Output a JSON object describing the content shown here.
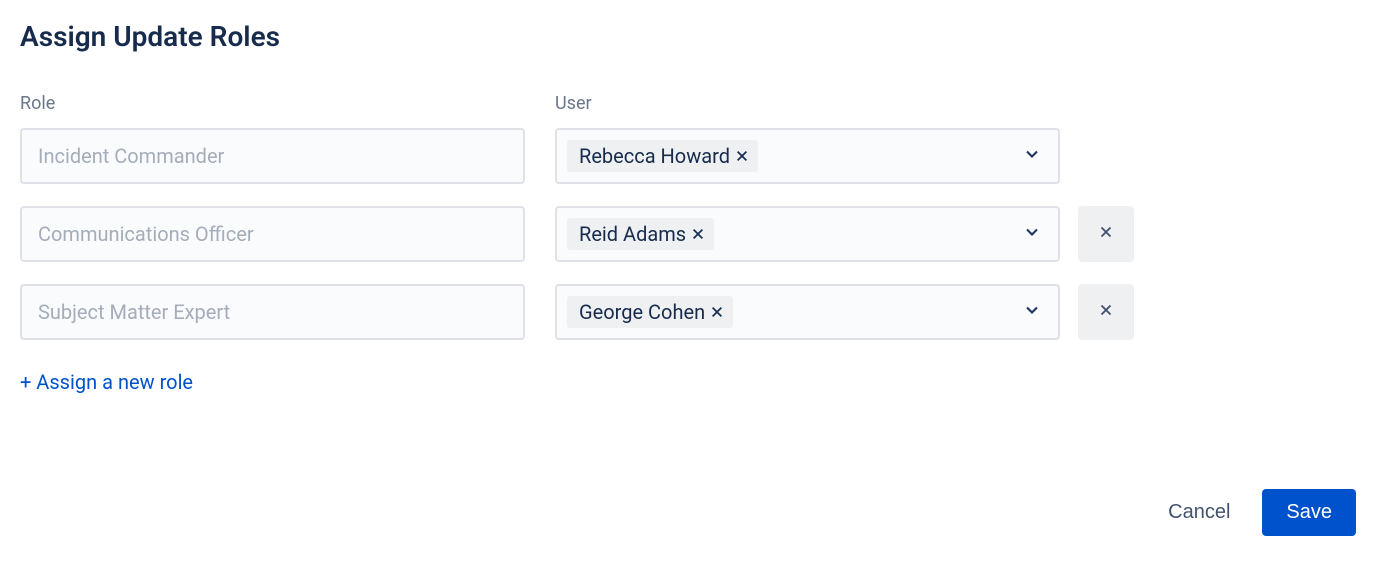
{
  "title": "Assign Update Roles",
  "headers": {
    "role": "Role",
    "user": "User"
  },
  "rows": [
    {
      "role": "Incident Commander",
      "user": "Rebecca Howard",
      "removable": false
    },
    {
      "role": "Communications Officer",
      "user": "Reid Adams",
      "removable": true
    },
    {
      "role": "Subject Matter Expert",
      "user": "George Cohen",
      "removable": true
    }
  ],
  "assign_link": "+ Assign a new role",
  "footer": {
    "cancel": "Cancel",
    "save": "Save"
  }
}
